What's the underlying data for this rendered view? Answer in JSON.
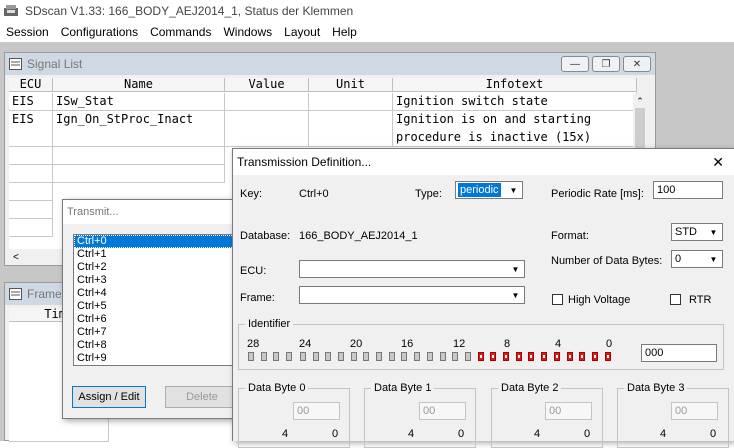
{
  "app": {
    "title": "SDscan V1.33: 166_BODY_AEJ2014_1, Status der Klemmen"
  },
  "menu": [
    "Session",
    "Configurations",
    "Commands",
    "Windows",
    "Layout",
    "Help"
  ],
  "signal_list": {
    "title": "Signal List",
    "columns": [
      "ECU",
      "Name",
      "Value",
      "Unit",
      "Infotext"
    ],
    "rows": [
      {
        "ecu": "EIS",
        "name": "ISw_Stat",
        "value": "",
        "unit": "",
        "info": "Ignition switch state"
      },
      {
        "ecu": "EIS",
        "name": "Ign_On_StProc_Inact",
        "value": "",
        "unit": "",
        "info": "Ignition is on and starting"
      },
      {
        "ecu": "",
        "name": "",
        "value": "",
        "unit": "",
        "info": "procedure is inactive (15x)"
      }
    ]
  },
  "frame_window": {
    "title": "Frame",
    "col": "Tim"
  },
  "transmit": {
    "title": "Transmit...",
    "items": [
      "Ctrl+0",
      "Ctrl+1",
      "Ctrl+2",
      "Ctrl+3",
      "Ctrl+4",
      "Ctrl+5",
      "Ctrl+6",
      "Ctrl+7",
      "Ctrl+8",
      "Ctrl+9"
    ],
    "selected_index": 0,
    "assign_label": "Assign / Edit",
    "delete_label": "Delete"
  },
  "tx_def": {
    "title": "Transmission Definition...",
    "key_label": "Key:",
    "key_value": "Ctrl+0",
    "type_label": "Type:",
    "type_value": "periodic",
    "rate_label": "Periodic Rate [ms]:",
    "rate_value": "100",
    "db_label": "Database:",
    "db_value": "166_BODY_AEJ2014_1",
    "format_label": "Format:",
    "format_value": "STD",
    "ecu_label": "ECU:",
    "ecu_value": "",
    "nbytes_label": "Number of Data Bytes:",
    "nbytes_value": "0",
    "frame_label": "Frame:",
    "frame_value": "",
    "hv_label": "High Voltage",
    "rtr_label": "RTR",
    "identifier_label": "Identifier",
    "bit_numbers": [
      "28",
      "24",
      "20",
      "16",
      "12",
      "8",
      "4",
      "0"
    ],
    "identifier_value": "000",
    "data_bytes": [
      {
        "label": "Data Byte 0",
        "value": "00",
        "hi": "4",
        "lo": "0"
      },
      {
        "label": "Data Byte 1",
        "value": "00",
        "hi": "4",
        "lo": "0"
      },
      {
        "label": "Data Byte 2",
        "value": "00",
        "hi": "4",
        "lo": "0"
      },
      {
        "label": "Data Byte 3",
        "value": "00",
        "hi": "4",
        "lo": "0"
      }
    ]
  },
  "colors": {
    "selection": "#0078d7",
    "bit_active": "#dd1a1a"
  }
}
